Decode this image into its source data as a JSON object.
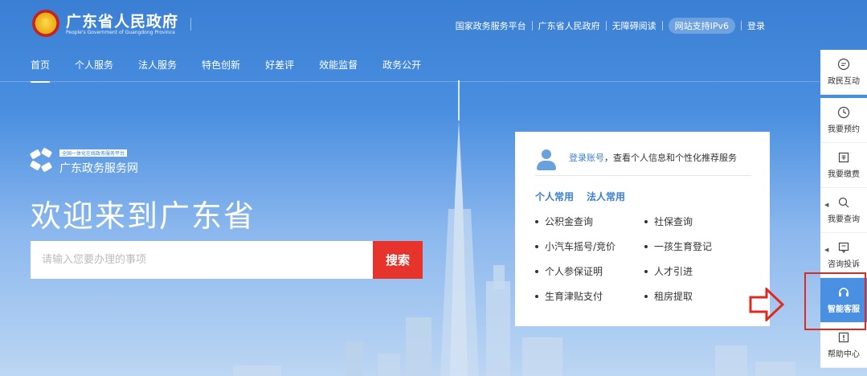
{
  "header": {
    "title": "广东省人民政府",
    "subtitle": "People's Government of Guangdong Province",
    "links": [
      "国家政务服务平台",
      "广东省人民政府",
      "无障碍阅读"
    ],
    "ipv6_badge": "网站支持IPv6",
    "login": "登录"
  },
  "nav": {
    "items": [
      "首页",
      "个人服务",
      "法人服务",
      "特色创新",
      "好差评",
      "效能监督",
      "政务公开"
    ],
    "active": "首页"
  },
  "hero": {
    "brand_tag": "全国一体化在线政务服务平台",
    "brand_name": "广东政务服务网",
    "welcome": "欢迎来到广东省",
    "search_placeholder": "请输入您要办理的事项",
    "search_button": "搜索"
  },
  "login_card": {
    "login_link": "登录账号",
    "login_text": "，查看个人信息和个性化推荐服务",
    "tabs": [
      "个人常用",
      "法人常用"
    ],
    "services": [
      "公积金查询",
      "社保查询",
      "小汽车摇号/竞价",
      "一孩生育登记",
      "个人参保证明",
      "人才引进",
      "生育津贴支付",
      "租房提取"
    ]
  },
  "toolbar": {
    "items": [
      {
        "label": "政民互动",
        "icon": "chat-bubble-icon"
      },
      {
        "label": "我要预约",
        "icon": "clock-icon"
      },
      {
        "label": "我要缴费",
        "icon": "payment-icon"
      },
      {
        "label": "我要查询",
        "icon": "search-icon"
      },
      {
        "label": "咨询投诉",
        "icon": "message-box-icon"
      },
      {
        "label": "智能客服",
        "icon": "headset-icon"
      },
      {
        "label": "帮助中心",
        "icon": "help-icon"
      }
    ]
  },
  "colors": {
    "primary": "#3a7fd3",
    "search_button": "#e6332c",
    "active_toolbar": "#4a90e2",
    "highlight": "#e02a20"
  }
}
